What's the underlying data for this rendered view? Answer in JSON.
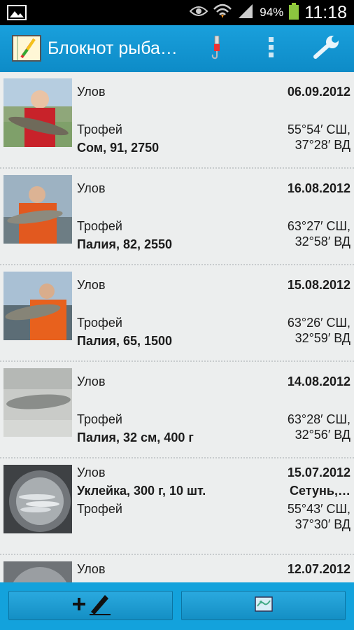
{
  "status_bar": {
    "battery": "94%",
    "time": "11:18"
  },
  "action_bar": {
    "title": "Блокнот рыба…"
  },
  "list": [
    {
      "label1": "Улов",
      "date": "06.09.2012",
      "label2": "Трофей",
      "fish": "Сом, 91, 2750",
      "lat": "55°54′ СШ,",
      "lon": "37°28′ ВД",
      "thumb": "thumb-1"
    },
    {
      "label1": "Улов",
      "date": "16.08.2012",
      "label2": "Трофей",
      "fish": "Палия, 82, 2550",
      "lat": "63°27′ СШ,",
      "lon": "32°58′ ВД",
      "thumb": "thumb-2"
    },
    {
      "label1": "Улов",
      "date": "15.08.2012",
      "label2": "Трофей",
      "fish": "Палия, 65, 1500",
      "lat": "63°26′ СШ,",
      "lon": "32°59′ ВД",
      "thumb": "thumb-3"
    },
    {
      "label1": "Улов",
      "date": "14.08.2012",
      "label2": "Трофей",
      "fish": "Палия, 32 см, 400 г",
      "lat": "63°28′ СШ,",
      "lon": "32°56′ ВД",
      "thumb": "thumb-4"
    },
    {
      "label1": "Улов",
      "date": "15.07.2012",
      "catch": "Уклейка, 300 г, 10 шт.",
      "place": "Сетунь,…",
      "label2": "Трофей",
      "lat": "55°43′ СШ,",
      "lon": "37°30′ ВД",
      "thumb": "thumb-5"
    },
    {
      "label1": "Улов",
      "date": "12.07.2012",
      "thumb": "thumb-6"
    }
  ],
  "colors": {
    "action_bar": "#0d8bc7",
    "bottom_bar": "#13a2dc",
    "list_bg": "#eceeee"
  }
}
